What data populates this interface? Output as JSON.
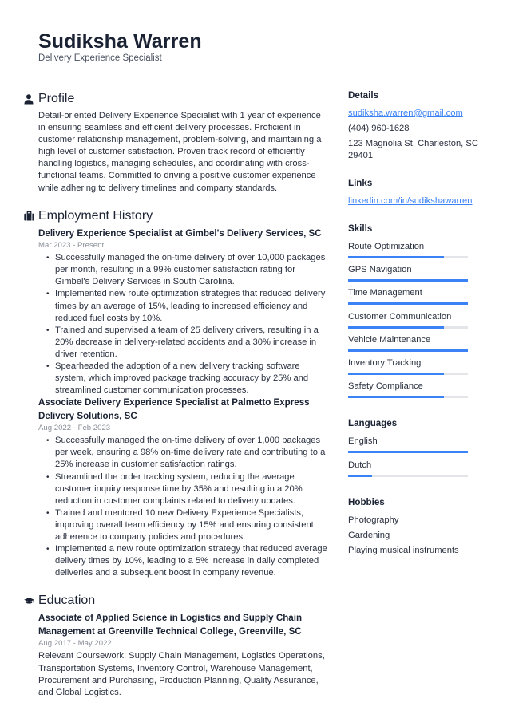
{
  "header": {
    "name": "Sudiksha Warren",
    "title": "Delivery Experience Specialist"
  },
  "profile": {
    "heading": "Profile",
    "icon": "person-icon",
    "text": "Detail-oriented Delivery Experience Specialist with 1 year of experience in ensuring seamless and efficient delivery processes. Proficient in customer relationship management, problem-solving, and maintaining a high level of customer satisfaction. Proven track record of efficiently handling logistics, managing schedules, and coordinating with cross-functional teams. Committed to driving a positive customer experience while adhering to delivery timelines and company standards."
  },
  "employment": {
    "heading": "Employment History",
    "icon": "briefcase-icon",
    "jobs": [
      {
        "title": "Delivery Experience Specialist at Gimbel's Delivery Services, SC",
        "dates": "Mar 2023 - Present",
        "bullets": [
          "Successfully managed the on-time delivery of over 10,000 packages per month, resulting in a 99% customer satisfaction rating for Gimbel's Delivery Services in South Carolina.",
          "Implemented new route optimization strategies that reduced delivery times by an average of 15%, leading to increased efficiency and reduced fuel costs by 10%.",
          "Trained and supervised a team of 25 delivery drivers, resulting in a 20% decrease in delivery-related accidents and a 30% increase in driver retention.",
          "Spearheaded the adoption of a new delivery tracking software system, which improved package tracking accuracy by 25% and streamlined customer communication processes."
        ]
      },
      {
        "title": "Associate Delivery Experience Specialist at Palmetto Express Delivery Solutions, SC",
        "dates": "Aug 2022 - Feb 2023",
        "bullets": [
          "Successfully managed the on-time delivery of over 1,000 packages per week, ensuring a 98% on-time delivery rate and contributing to a 25% increase in customer satisfaction ratings.",
          "Streamlined the order tracking system, reducing the average customer inquiry response time by 35% and resulting in a 20% reduction in customer complaints related to delivery updates.",
          "Trained and mentored 10 new Delivery Experience Specialists, improving overall team efficiency by 15% and ensuring consistent adherence to company policies and procedures.",
          "Implemented a new route optimization strategy that reduced average delivery times by 10%, leading to a 5% increase in daily completed deliveries and a subsequent boost in company revenue."
        ]
      }
    ]
  },
  "education": {
    "heading": "Education",
    "icon": "graduation-cap-icon",
    "entries": [
      {
        "title": "Associate of Applied Science in Logistics and Supply Chain Management at Greenville Technical College, Greenville, SC",
        "dates": "Aug 2017 - May 2022",
        "description": "Relevant Coursework: Supply Chain Management, Logistics Operations, Transportation Systems, Inventory Control, Warehouse Management, Procurement and Purchasing, Production Planning, Quality Assurance, and Global Logistics."
      }
    ]
  },
  "details": {
    "heading": "Details",
    "email": "sudiksha.warren@gmail.com",
    "phone": "(404) 960-1628",
    "address": "123 Magnolia St, Charleston, SC 29401"
  },
  "links": {
    "heading": "Links",
    "items": [
      "linkedin.com/in/sudikshawarren"
    ]
  },
  "skills": {
    "heading": "Skills",
    "items": [
      {
        "label": "Route Optimization",
        "level": 0.8
      },
      {
        "label": "GPS Navigation",
        "level": 1.0
      },
      {
        "label": "Time Management",
        "level": 1.0
      },
      {
        "label": "Customer Communication",
        "level": 0.8
      },
      {
        "label": "Vehicle Maintenance",
        "level": 1.0
      },
      {
        "label": "Inventory Tracking",
        "level": 0.8
      },
      {
        "label": "Safety Compliance",
        "level": 0.8
      }
    ]
  },
  "languages": {
    "heading": "Languages",
    "items": [
      {
        "label": "English",
        "level": 1.0
      },
      {
        "label": "Dutch",
        "level": 0.2
      }
    ]
  },
  "hobbies": {
    "heading": "Hobbies",
    "items": [
      "Photography",
      "Gardening",
      "Playing musical instruments"
    ]
  },
  "colors": {
    "accent": "#3b82f6",
    "text": "#1a2233",
    "muted": "#8a8f98",
    "track": "#e3e5e8"
  }
}
